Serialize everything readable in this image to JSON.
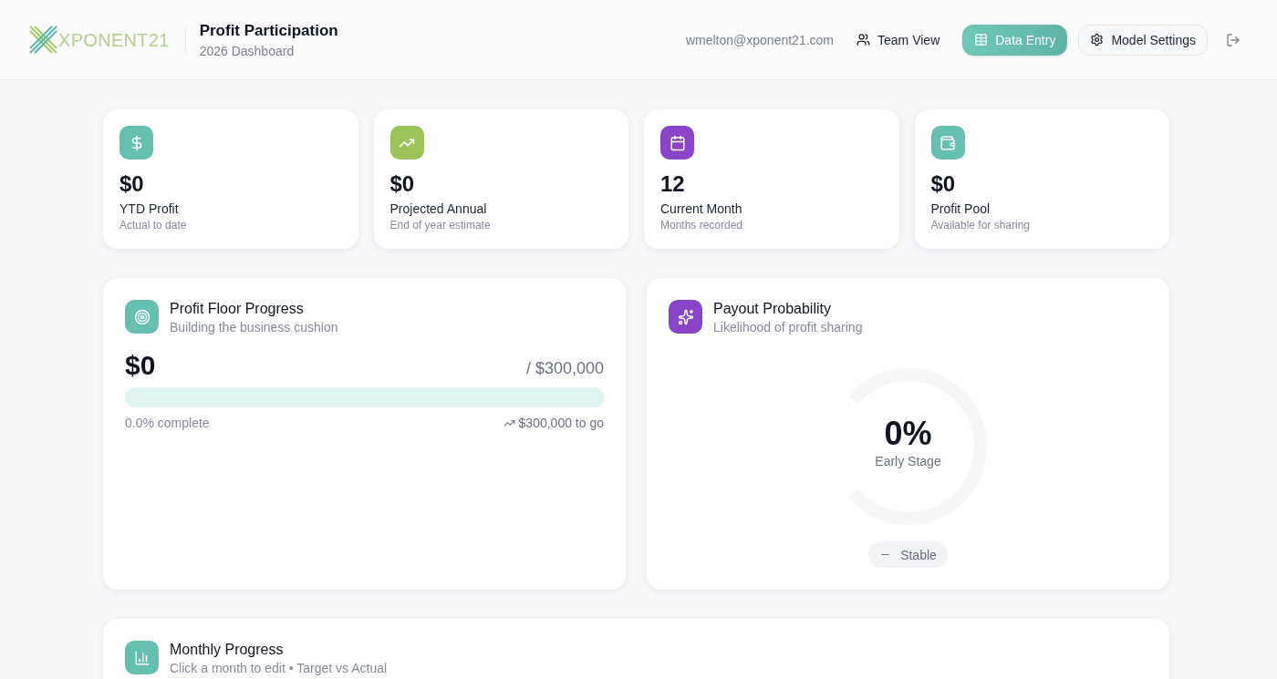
{
  "header": {
    "logo": "XPONENT21",
    "title": "Profit Participation",
    "subtitle": "2026 Dashboard",
    "email": "wmelton@xponent21.com",
    "nav": [
      {
        "label": "Team View",
        "kind": "ghost",
        "selected": false
      },
      {
        "label": "Data Entry",
        "kind": "outline",
        "selected": true
      },
      {
        "label": "Model Settings",
        "kind": "outline",
        "selected": false
      }
    ]
  },
  "stats": [
    {
      "value": "$0",
      "label": "YTD Profit",
      "caption": "Actual to date",
      "color": "#66c0b0"
    },
    {
      "value": "$0",
      "label": "Projected Annual",
      "caption": "End of year estimate",
      "color": "#9cc35a"
    },
    {
      "value": "12",
      "label": "Current Month",
      "caption": "Months recorded",
      "color": "#8a44c8"
    },
    {
      "value": "$0",
      "label": "Profit Pool",
      "caption": "Available for sharing",
      "color": "#66c0b0"
    }
  ],
  "profit_floor": {
    "title": "Profit Floor Progress",
    "subtitle": "Building the business cushion",
    "current": "$0",
    "target": "/ $300,000",
    "level": 0,
    "complete": "0.0% complete",
    "remaining": "$300,000 to go"
  },
  "payout": {
    "title": "Payout Probability",
    "subtitle": "Likelihood of profit sharing",
    "value": "0%",
    "stage": "Early Stage",
    "level": 0,
    "trend": "Stable"
  },
  "monthly": {
    "title": "Monthly Progress",
    "subtitle": "Click a month to edit • Target vs Actual"
  }
}
